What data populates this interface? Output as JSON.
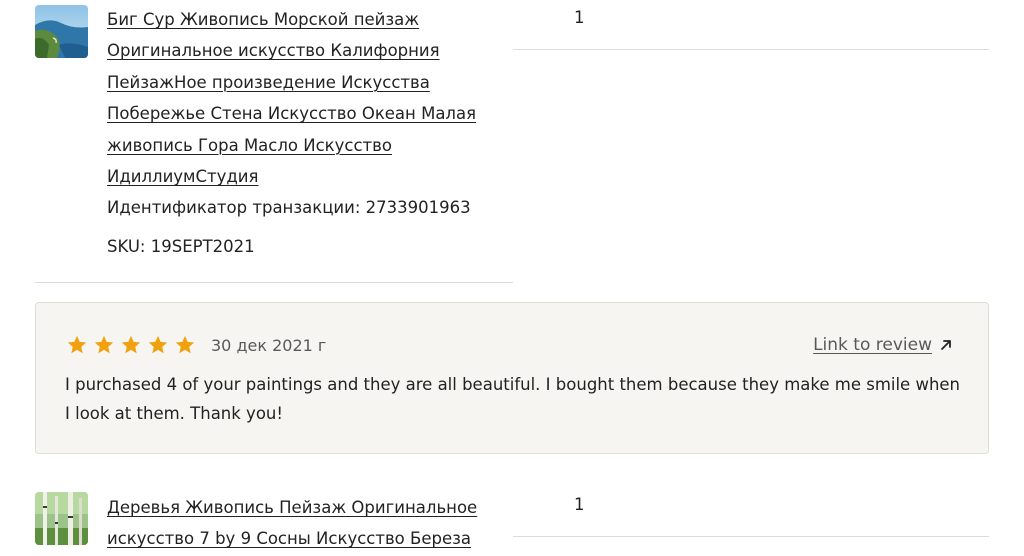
{
  "orders": [
    {
      "thumbnail": "seascape-painting-thumbnail",
      "title_lines": [
        "Биг Сур Живопись Морской пейзаж",
        "Оригинальное искусство Калифорния",
        "ПейзажНое произведение Искусства",
        "Побережье Стена Искусство Океан Малая",
        "живопись Гора Масло Искусство",
        "ИдиллиумСтудия"
      ],
      "transaction": "Идентификатор транзакции: 2733901963",
      "sku": "SKU: 19SEPT2021",
      "quantity": "1"
    },
    {
      "thumbnail": "birch-trees-painting-thumbnail",
      "title_lines": [
        "Деревья Живопись Пейзаж Оригинальное",
        "искусство 7 by 9 Сосны Искусство Береза"
      ],
      "quantity": "1"
    }
  ],
  "review": {
    "rating": 5,
    "star_icon": "star-icon",
    "star_color": "#f1a10d",
    "date": "30 дек 2021 г",
    "link_label": "Link to review",
    "link_icon": "arrow-up-right-icon",
    "text": "I purchased 4 of your paintings and they are all beautiful. I bought them because they make me smile when I look at them. Thank you!"
  }
}
